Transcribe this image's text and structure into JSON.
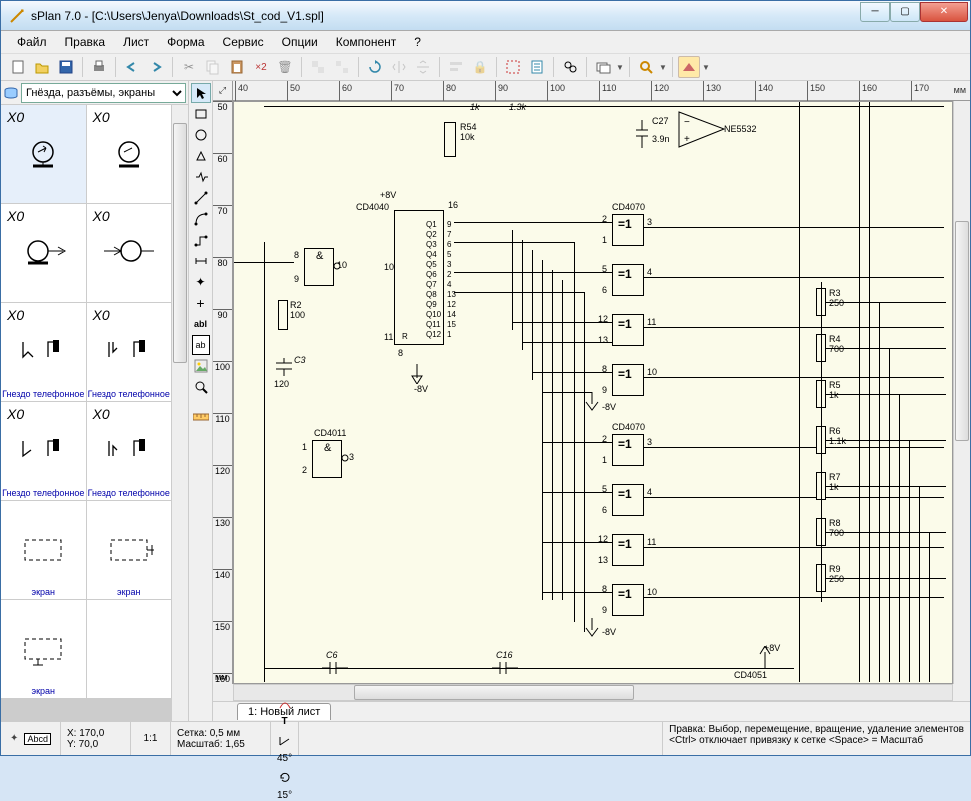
{
  "title": "sPlan 7.0 - [C:\\Users\\Jenya\\Downloads\\St_cod_V1.spl]",
  "menu": [
    "Файл",
    "Правка",
    "Лист",
    "Форма",
    "Сервис",
    "Опции",
    "Компонент",
    "?"
  ],
  "library": {
    "selector": "Гнёзда, разъёмы, экраны",
    "cells": [
      {
        "top": "X0",
        "bottom": "",
        "selected": true
      },
      {
        "top": "X0",
        "bottom": ""
      },
      {
        "top": "X0",
        "bottom": ""
      },
      {
        "top": "X0",
        "bottom": ""
      },
      {
        "top": "X0",
        "bottom": "Гнездо телефонное"
      },
      {
        "top": "X0",
        "bottom": "Гнездо телефонное"
      },
      {
        "top": "X0",
        "bottom": "Гнездо телефонное"
      },
      {
        "top": "X0",
        "bottom": "Гнездо телефонное"
      },
      {
        "top": "",
        "bottom": "экран"
      },
      {
        "top": "",
        "bottom": "экран"
      },
      {
        "top": "",
        "bottom": "экран"
      }
    ]
  },
  "ruler_h": [
    "40",
    "50",
    "60",
    "70",
    "80",
    "90",
    "100",
    "110",
    "120",
    "130",
    "140",
    "150",
    "160",
    "170"
  ],
  "ruler_h_unit": "мм",
  "ruler_v": [
    "50",
    "60",
    "70",
    "80",
    "90",
    "100",
    "110",
    "120",
    "130",
    "140",
    "150",
    "160"
  ],
  "ruler_v_unit": "мм",
  "sheet_tab": "1: Новый лист",
  "schematic": {
    "components": {
      "R54": {
        "label": "R54",
        "val": "10k"
      },
      "C27": {
        "label": "C27",
        "val": "3.9n"
      },
      "NE5532": "NE5532",
      "CD4040": "CD4040",
      "CD4011": "CD4011",
      "CD4070_top": "CD4070",
      "CD4070_bot": "CD4070",
      "CD4051": "CD4051",
      "R2": {
        "label": "R2",
        "val": "100"
      },
      "C3": {
        "label": "C3",
        "val": "120"
      },
      "R3": {
        "label": "R3",
        "val": "250"
      },
      "R4": {
        "label": "R4",
        "val": "700"
      },
      "R5": {
        "label": "R5",
        "val": "1k"
      },
      "R6": {
        "label": "R6",
        "val": "1.1k"
      },
      "R7": {
        "label": "R7",
        "val": "1k"
      },
      "R8": {
        "label": "R8",
        "val": "700"
      },
      "R9": {
        "label": "R9",
        "val": "250"
      },
      "C6": "C6",
      "C16": "C16",
      "plus8v": "+8V",
      "minus8v": "-8V",
      "oneK": "1k",
      "one3k": "1.3k"
    },
    "pins": {
      "p1": "1",
      "p2": "2",
      "p3": "3",
      "p4": "4",
      "p5": "5",
      "p6": "6",
      "p7": "7",
      "p8": "8",
      "p9": "9",
      "p10": "10",
      "p11": "11",
      "p12": "12",
      "p13": "13",
      "p16": "16"
    },
    "gate_amp": "&",
    "gate_eq": "=1"
  },
  "status": {
    "coord_tool": "+",
    "abcd": "Abcd",
    "x": "X: 170,0",
    "y": "Y: 70,0",
    "ratio": "1:1",
    "grid": "Сетка: 0,5 мм",
    "scale": "Масштаб:  1,65",
    "angle1": "45°",
    "angle2": "15°",
    "hint1": "Правка: Выбор, перемещение, вращение, удаление элементов",
    "hint2": "<Ctrl> отключает привязку к сетке <Space> = Масштаб"
  }
}
